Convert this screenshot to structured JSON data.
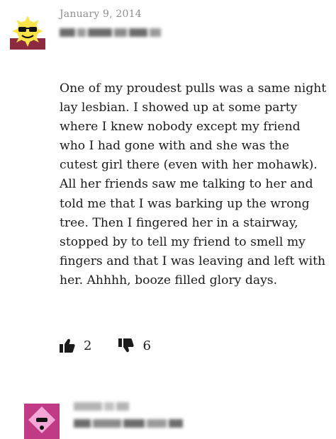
{
  "comments": [
    {
      "avatar_icon": "sunglasses-sun-avatar-icon",
      "avatar_bg": "#8e2a3f",
      "date": "January 9, 2014",
      "author_redacted": true,
      "text": "One of my proudest pulls was a same night\nlay lesbian. I showed up at some party\nwhere I knew nobody except my friend\nwho I had gone with and she was the\ncutest girl there (even with her mohawk).\nAll her friends saw me talking to her and\ntold me that I was barking up the wrong\ntree. Then I fingered her in a stairway,\nstopped by to tell my friend to smell my\nfingers and that I was leaving and left with\nher. Ahhhh, booze filled glory days.",
      "upvotes": "2",
      "downvotes": "6"
    },
    {
      "avatar_icon": "pink-diamond-avatar-icon",
      "avatar_bg": "#c13a86",
      "date_redacted": true,
      "author_redacted": true
    }
  ],
  "icons": {
    "upvote": "thumbs-up-icon",
    "downvote": "thumbs-down-icon"
  }
}
